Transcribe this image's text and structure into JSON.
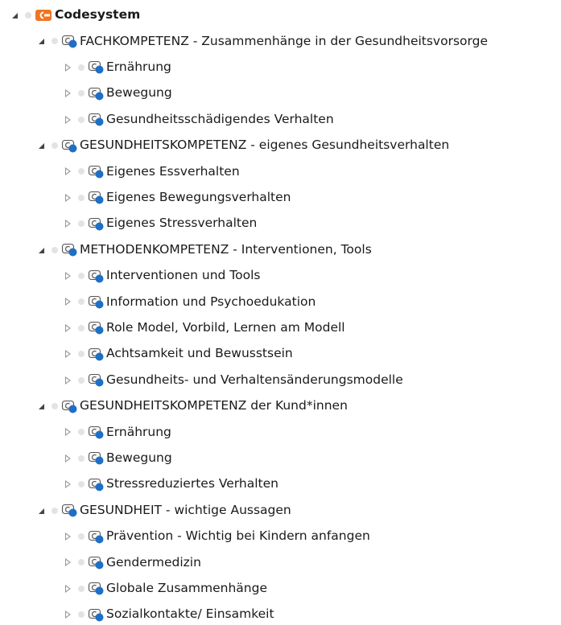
{
  "tree": {
    "root": {
      "label": "Codesystem",
      "icon": "codesystem-icon",
      "expanded": true
    },
    "groups": [
      {
        "label": "FACHKOMPETENZ - Zusammenhänge in der Gesundheitsvorsorge",
        "expanded": true,
        "children": [
          "Ernährung",
          "Bewegung",
          "Gesundheitsschädigendes Verhalten"
        ]
      },
      {
        "label": "GESUNDHEITSKOMPETENZ - eigenes Gesundheitsverhalten",
        "expanded": true,
        "children": [
          "Eigenes Essverhalten",
          "Eigenes Bewegungsverhalten",
          "Eigenes Stressverhalten"
        ]
      },
      {
        "label": "METHODENKOMPETENZ - Interventionen, Tools",
        "expanded": true,
        "children": [
          "Interventionen und Tools",
          "Information und Psychoedukation",
          "Role Model, Vorbild, Lernen am Modell",
          "Achtsamkeit und Bewusstsein",
          "Gesundheits- und Verhaltensänderungsmodelle"
        ]
      },
      {
        "label": "GESUNDHEITSKOMPETENZ der Kund*innen",
        "expanded": true,
        "children": [
          "Ernährung",
          "Bewegung",
          "Stressreduziertes Verhalten"
        ]
      },
      {
        "label": "GESUNDHEIT - wichtige Aussagen",
        "expanded": true,
        "children": [
          "Prävention - Wichtig bei Kindern anfangen",
          "Gendermedizin",
          "Globale Zusammenhänge",
          "Sozialkontakte/ Einsamkeit"
        ]
      }
    ]
  },
  "colors": {
    "root_icon": "#f07623",
    "code_dot": "#1f6fc6",
    "code_outline": "#555555",
    "color_dot": "#e3e3e3"
  }
}
